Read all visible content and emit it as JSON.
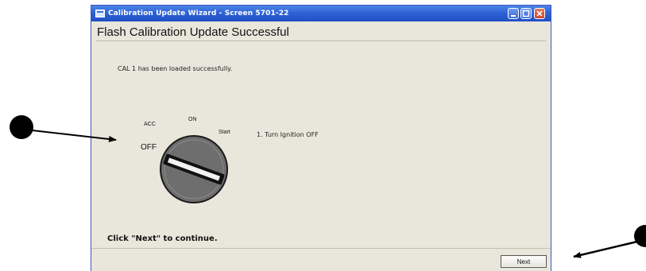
{
  "window": {
    "title": "Calibration Update Wizard - Screen 5701-22",
    "controls": [
      "minimize-icon",
      "maximize-icon",
      "close-icon"
    ],
    "titlebar_color": "#2f63d6"
  },
  "main": {
    "heading": "Flash Calibration Update Successful",
    "message": "CAL 1 has been loaded successfully.",
    "ignition": {
      "labels": {
        "acc": "ACC",
        "on": "ON",
        "start": "Start",
        "off": "OFF"
      }
    },
    "instruction": "1. Turn Ignition OFF",
    "continue_text": "Click \"Next\" to continue."
  },
  "footer": {
    "next_label": "Next"
  }
}
